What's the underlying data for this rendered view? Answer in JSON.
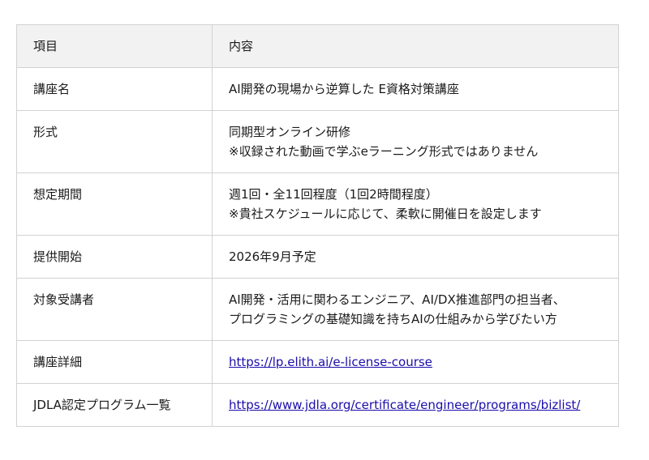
{
  "table": {
    "header": {
      "label": "項目",
      "value": "内容"
    },
    "rows": [
      {
        "label": "講座名",
        "lines": [
          "AI開発の現場から逆算した E資格対策講座"
        ]
      },
      {
        "label": "形式",
        "lines": [
          "同期型オンライン研修",
          "※収録された動画で学ぶeラーニング形式ではありません"
        ]
      },
      {
        "label": "想定期間",
        "lines": [
          "週1回・全11回程度（1回2時間程度）",
          "※貴社スケジュールに応じて、柔軟に開催日を設定します"
        ]
      },
      {
        "label": "提供開始",
        "lines": [
          "2026年9月予定"
        ]
      },
      {
        "label": "対象受講者",
        "lines": [
          "AI開発・活用に関わるエンジニア、AI/DX推進部門の担当者、",
          "プログラミングの基礎知識を持ちAIの仕組みから学びたい方"
        ]
      },
      {
        "label": "講座詳細",
        "link": "https://lp.elith.ai/e-license-course"
      },
      {
        "label": "JDLA認定プログラム一覧",
        "link": "https://www.jdla.org/certificate/engineer/programs/bizlist/"
      }
    ]
  },
  "colors": {
    "header_bg": "#f2f2f2",
    "border": "#d2d2d2",
    "link": "#1a0dab"
  }
}
